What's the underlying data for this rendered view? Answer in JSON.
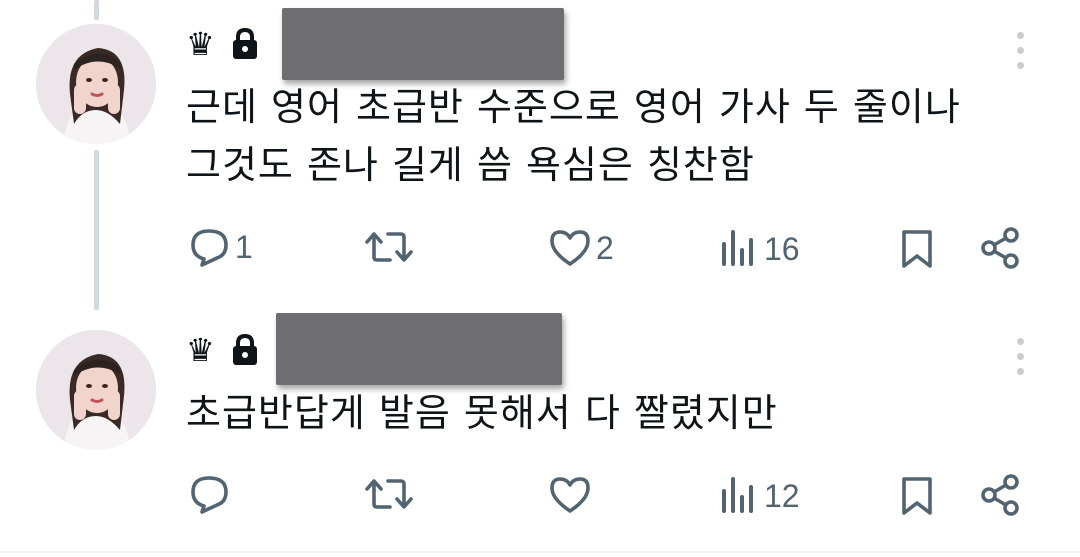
{
  "tweets": [
    {
      "text": "근데 영어 초급반 수준으로 영어 가사 두 줄이나\n그것도 존나 길게 씀 욕심은 칭찬함",
      "badge": "♛",
      "icons": {
        "badge": "crown-icon",
        "lock": "lock-icon",
        "more": "more-vertical-icon",
        "avatar": "profile-photo"
      },
      "stats": {
        "replies": "1",
        "retweets": "",
        "likes": "2",
        "views": "16"
      }
    },
    {
      "text": "초급반답게 발음 못해서 다 짤렸지만",
      "badge": "♛",
      "icons": {
        "badge": "crown-icon",
        "lock": "lock-icon",
        "more": "more-vertical-icon",
        "avatar": "profile-photo"
      },
      "stats": {
        "replies": "",
        "retweets": "",
        "likes": "",
        "views": "12"
      }
    }
  ],
  "action_icons": [
    "reply-icon",
    "retweet-icon",
    "like-icon",
    "views-icon",
    "bookmark-icon",
    "share-icon"
  ],
  "colors": {
    "text": "#0f1419",
    "secondary": "#536471",
    "thread_line": "#cfd9de",
    "redaction": "#6e6e72"
  }
}
